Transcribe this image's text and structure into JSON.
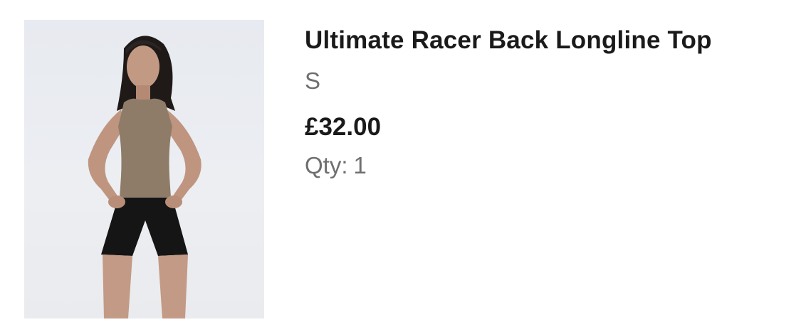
{
  "cart_item": {
    "product": {
      "title": "Ultimate Racer Back Longline Top",
      "size": "S",
      "price": "£32.00",
      "quantity_label": "Qty:",
      "quantity_value": "1",
      "image_icon": "product-photo"
    }
  }
}
